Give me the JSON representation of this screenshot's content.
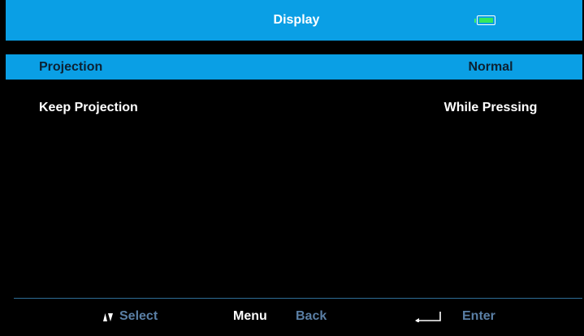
{
  "header": {
    "title": "Display",
    "battery_icon": "battery-full-icon",
    "accent_color": "#0a9fe5",
    "battery_color": "#34e85c"
  },
  "menu": {
    "items": [
      {
        "label": "Projection",
        "value": "Normal",
        "selected": true
      },
      {
        "label": "Keep Projection",
        "value": "While Pressing",
        "selected": false
      }
    ]
  },
  "footer": {
    "select_icon": "up-down-arrows-icon",
    "select_label": "Select",
    "menu_key": "Menu",
    "back_label": "Back",
    "enter_icon": "enter-return-icon",
    "enter_label": "Enter"
  }
}
